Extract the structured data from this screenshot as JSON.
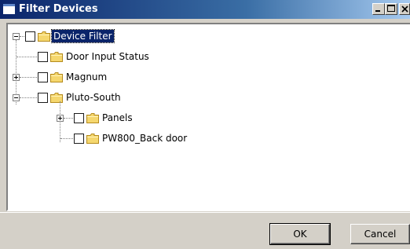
{
  "window": {
    "title": "Filter Devices",
    "minimize_glyph": "_",
    "maximize_glyph": "□",
    "close_glyph": "✕"
  },
  "tree": {
    "nodes": [
      {
        "label": "Device Filter",
        "expander": "minus",
        "checked": false,
        "selected": true
      },
      {
        "label": "Door Input Status",
        "expander": "none",
        "checked": false,
        "selected": false
      },
      {
        "label": "Magnum",
        "expander": "plus",
        "checked": false,
        "selected": false
      },
      {
        "label": "Pluto-South",
        "expander": "minus",
        "checked": false,
        "selected": false
      },
      {
        "label": "Panels",
        "expander": "plus",
        "checked": false,
        "selected": false
      },
      {
        "label": "PW800_Back door",
        "expander": "none",
        "checked": false,
        "selected": false
      }
    ]
  },
  "buttons": {
    "ok_label": "OK",
    "cancel_label": "Cancel"
  },
  "colors": {
    "titlebar_start": "#0a246a",
    "selection": "#0a246a",
    "folder_yellow": "#f5d76e",
    "dialog_face": "#d4d0c8"
  },
  "icons": {
    "folder": "folder-icon",
    "checkbox": "checkbox-icon",
    "expander_plus": "plus-expander-icon",
    "expander_minus": "minus-expander-icon"
  }
}
